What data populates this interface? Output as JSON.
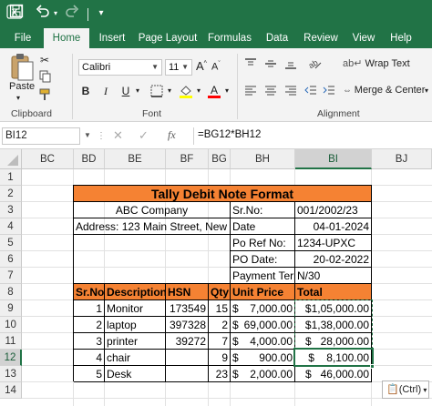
{
  "titlebar": {
    "undo_icon": "undo-icon",
    "redo_icon": "redo-icon",
    "save_icon": "save-icon"
  },
  "tabs": [
    "File",
    "Home",
    "Insert",
    "Page Layout",
    "Formulas",
    "Data",
    "Review",
    "View",
    "Help"
  ],
  "ribbon": {
    "paste_label": "Paste",
    "clipboard_label": "Clipboard",
    "font_label": "Font",
    "alignment_label": "Alignment",
    "font_name": "Calibri",
    "font_size": "11",
    "grow_font": "A",
    "shrink_font": "A",
    "bold": "B",
    "italic": "I",
    "underline": "U",
    "wrap_text": "Wrap Text",
    "merge_center": "Merge & Center"
  },
  "formula_bar": {
    "name_box": "BI12",
    "fx": "fx",
    "formula": "=BG12*BH12"
  },
  "columns": [
    "BC",
    "BD",
    "BE",
    "BF",
    "BG",
    "BH",
    "BI",
    "BJ"
  ],
  "rows": [
    "1",
    "2",
    "3",
    "4",
    "5",
    "6",
    "7",
    "8",
    "9",
    "10",
    "11",
    "12",
    "13",
    "14"
  ],
  "sheet": {
    "title": "Tally Debit Note Format",
    "company": "ABC Company",
    "address": "Address: 123 Main Street, New",
    "srno_label": "Sr.No:",
    "srno_value": "001/2002/23",
    "date_label": "Date",
    "date_value": "04-01-2024",
    "poref_label": "Po Ref No:",
    "poref_value": "1234-UPXC",
    "podate_label": "PO Date:",
    "podate_value": "20-02-2022",
    "payterm_label": "Payment Terr",
    "payterm_value": "N/30",
    "headers": {
      "srno": "Sr.No",
      "description": "Description",
      "hsn": "HSN",
      "qty": "Qty",
      "unit_price": "Unit Price",
      "total": "Total"
    },
    "items": [
      {
        "srno": "1",
        "description": "Monitor",
        "hsn": "173549",
        "qty": "15",
        "cur": "$",
        "unit_price": "7,000.00",
        "total": "$1,05,000.00"
      },
      {
        "srno": "2",
        "description": "laptop",
        "hsn": "397328",
        "qty": "2",
        "cur": "$",
        "unit_price": "69,000.00",
        "total": "$1,38,000.00"
      },
      {
        "srno": "3",
        "description": "printer",
        "hsn": "39272",
        "qty": "7",
        "cur": "$",
        "unit_price": "4,000.00",
        "total": "$   28,000.00"
      },
      {
        "srno": "4",
        "description": "chair",
        "hsn": "",
        "qty": "9",
        "cur": "$",
        "unit_price": "900.00",
        "total": "$    8,100.00"
      },
      {
        "srno": "5",
        "description": "Desk",
        "hsn": "",
        "qty": "23",
        "cur": "$",
        "unit_price": "2,000.00",
        "total": "$   46,000.00"
      }
    ]
  },
  "paste_options": "(Ctrl)"
}
